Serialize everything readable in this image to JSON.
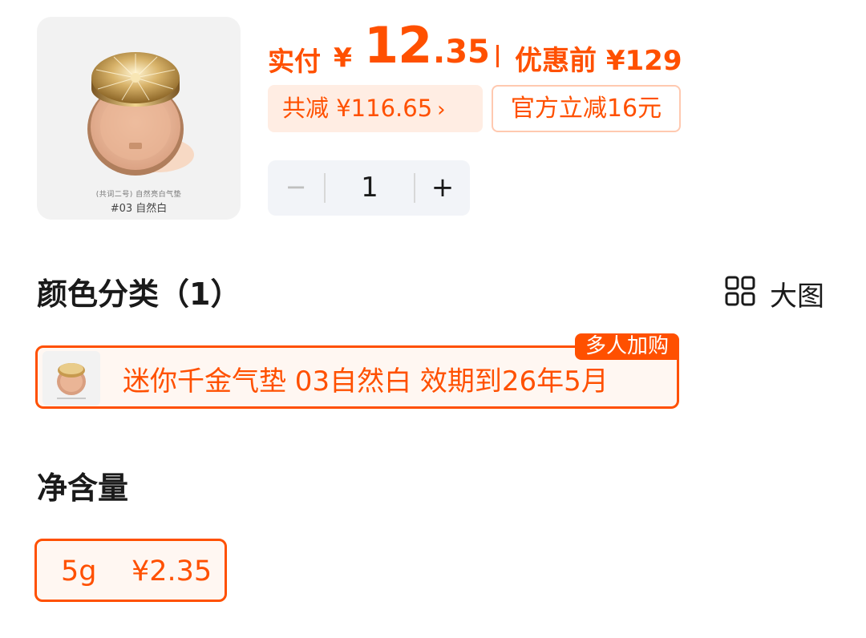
{
  "product": {
    "image_icon": "cushion-compact-icon",
    "image_caption_small": "(共词二号) 自然亮白气垫",
    "image_caption": "#03 自然白"
  },
  "price": {
    "paid_label": "实付",
    "currency": "¥",
    "paid_integer": "12",
    "paid_decimal": ".35",
    "original_label": "优惠前",
    "original_price": "¥129",
    "total_discount": "共减 ¥116.65",
    "official_discount": "官方立减16元"
  },
  "quantity": {
    "minus": "−",
    "value": "1",
    "plus": "+"
  },
  "color_section": {
    "title": "颜色分类（1）",
    "big_image_label": "大图",
    "options": [
      {
        "label": "迷你千金气垫 03自然白  效期到26年5月",
        "badge": "多人加购",
        "selected": true
      }
    ]
  },
  "net_content_section": {
    "title": "净含量",
    "options": [
      {
        "size": "5g",
        "price": "¥2.35",
        "selected": true
      }
    ]
  },
  "colors": {
    "accent": "#ff5000",
    "pill_bg": "#ffede3",
    "stepper_bg": "#f2f4f8"
  }
}
